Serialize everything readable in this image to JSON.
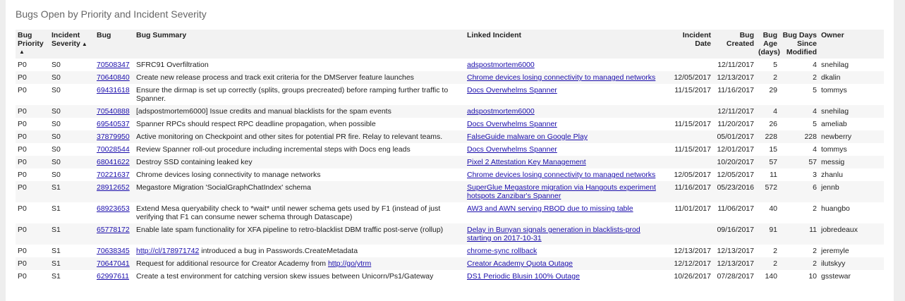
{
  "title": "Bugs Open by Priority and Incident Severity",
  "sort_up_glyph": "▲",
  "columns": [
    {
      "key": "priority",
      "label": "Bug Priority",
      "sorted": "asc",
      "arrow_below": true
    },
    {
      "key": "severity",
      "label": "Incident Severity",
      "sorted": "asc",
      "arrow_below": false
    },
    {
      "key": "bug",
      "label": "Bug"
    },
    {
      "key": "summary",
      "label": "Bug Summary"
    },
    {
      "key": "incident",
      "label": "Linked Incident"
    },
    {
      "key": "incident_date",
      "label": "Incident Date",
      "numeric": true
    },
    {
      "key": "bug_created",
      "label": "Bug Created",
      "numeric": true
    },
    {
      "key": "bug_age",
      "label": "Bug Age (days)",
      "numeric": true
    },
    {
      "key": "days_modified",
      "label": "Bug Days Since Modified",
      "numeric": true
    },
    {
      "key": "owner",
      "label": "Owner"
    }
  ],
  "rows": [
    {
      "priority": "P0",
      "severity": "S0",
      "bug": "70508347",
      "summary": [
        {
          "t": "SFRC91 Overfiltration"
        }
      ],
      "incident": "adspostmortem6000",
      "incident_date": "",
      "bug_created": "12/11/2017",
      "bug_age": "5",
      "days_modified": "4",
      "owner": "snehilag"
    },
    {
      "priority": "P0",
      "severity": "S0",
      "bug": "70640840",
      "summary": [
        {
          "t": "Create new release process and track exit criteria for the DMServer feature launches"
        }
      ],
      "incident": "Chrome devices losing connectivity to managed networks",
      "incident_date": "12/05/2017",
      "bug_created": "12/13/2017",
      "bug_age": "2",
      "days_modified": "2",
      "owner": "dkalin"
    },
    {
      "priority": "P0",
      "severity": "S0",
      "bug": "69431618",
      "summary": [
        {
          "t": "Ensure the dirmap is set up correctly (splits, groups precreated) before ramping further traffic to Spanner."
        }
      ],
      "incident": "Docs Overwhelms Spanner",
      "incident_date": "11/15/2017",
      "bug_created": "11/16/2017",
      "bug_age": "29",
      "days_modified": "5",
      "owner": "tommys"
    },
    {
      "priority": "P0",
      "severity": "S0",
      "bug": "70540888",
      "summary": [
        {
          "t": "[adspostmortem6000] Issue credits and manual blacklists for the spam events"
        }
      ],
      "incident": "adspostmortem6000",
      "incident_date": "",
      "bug_created": "12/11/2017",
      "bug_age": "4",
      "days_modified": "4",
      "owner": "snehilag"
    },
    {
      "priority": "P0",
      "severity": "S0",
      "bug": "69540537",
      "summary": [
        {
          "t": "Spanner RPCs should respect RPC deadline propagation, when possible"
        }
      ],
      "incident": "Docs Overwhelms Spanner",
      "incident_date": "11/15/2017",
      "bug_created": "11/20/2017",
      "bug_age": "26",
      "days_modified": "5",
      "owner": "ameliab"
    },
    {
      "priority": "P0",
      "severity": "S0",
      "bug": "37879950",
      "summary": [
        {
          "t": "Active monitoring on Checkpoint and other sites for potential PR fire. Relay to relevant teams."
        }
      ],
      "incident": "FalseGuide malware on Google Play",
      "incident_date": "",
      "bug_created": "05/01/2017",
      "bug_age": "228",
      "days_modified": "228",
      "owner": "newberry"
    },
    {
      "priority": "P0",
      "severity": "S0",
      "bug": "70028544",
      "summary": [
        {
          "t": "Review Spanner roll-out procedure including incremental steps with Docs eng leads"
        }
      ],
      "incident": "Docs Overwhelms Spanner",
      "incident_date": "11/15/2017",
      "bug_created": "12/01/2017",
      "bug_age": "15",
      "days_modified": "4",
      "owner": "tommys"
    },
    {
      "priority": "P0",
      "severity": "S0",
      "bug": "68041622",
      "summary": [
        {
          "t": "Destroy SSD containing leaked key"
        }
      ],
      "incident": "Pixel 2 Attestation Key Management",
      "incident_date": "",
      "bug_created": "10/20/2017",
      "bug_age": "57",
      "days_modified": "57",
      "owner": "messig"
    },
    {
      "priority": "P0",
      "severity": "S0",
      "bug": "70221637",
      "summary": [
        {
          "t": "Chrome devices losing connectivity to manage networks"
        }
      ],
      "incident": "Chrome devices losing connectivity to managed networks",
      "incident_date": "12/05/2017",
      "bug_created": "12/05/2017",
      "bug_age": "11",
      "days_modified": "3",
      "owner": "zhanlu"
    },
    {
      "priority": "P0",
      "severity": "S1",
      "bug": "28912652",
      "summary": [
        {
          "t": "Megastore Migration 'SocialGraphChatIndex' schema"
        }
      ],
      "incident": "SuperGlue Megastore migration via Hangouts experiment hotspots Zanzibar's Spanner",
      "incident_date": "11/16/2017",
      "bug_created": "05/23/2016",
      "bug_age": "572",
      "days_modified": "6",
      "owner": "jennb"
    },
    {
      "priority": "P0",
      "severity": "S1",
      "bug": "68923653",
      "summary": [
        {
          "t": "Extend Mesa queryability check to *wait* until newer schema gets used by F1 (instead of just verifying that F1 can consume newer schema through Datascape)"
        }
      ],
      "incident": "AW3 and AWN serving RBOD due to missing table",
      "incident_date": "11/01/2017",
      "bug_created": "11/06/2017",
      "bug_age": "40",
      "days_modified": "2",
      "owner": "huangbo"
    },
    {
      "priority": "P0",
      "severity": "S1",
      "bug": "65778172",
      "summary": [
        {
          "t": "Enable late spam functionality for XFA pipeline to retro-blacklist DBM traffic post-serve (rollup)"
        }
      ],
      "incident": "Delay in Bunyan signals generation in blacklists-prod starting on 2017-10-31",
      "incident_date": "",
      "bug_created": "09/16/2017",
      "bug_age": "91",
      "days_modified": "11",
      "owner": "jobredeaux"
    },
    {
      "priority": "P0",
      "severity": "S1",
      "bug": "70638345",
      "summary": [
        {
          "t": "http://cl/178971742",
          "link": true
        },
        {
          "t": " introduced a bug in Passwords.CreateMetadata"
        }
      ],
      "incident": "chrome-sync rollback",
      "incident_date": "12/13/2017",
      "bug_created": "12/13/2017",
      "bug_age": "2",
      "days_modified": "2",
      "owner": "jeremyle"
    },
    {
      "priority": "P0",
      "severity": "S1",
      "bug": "70647041",
      "summary": [
        {
          "t": "Request for additional resource for Creator Academy from "
        },
        {
          "t": "http://go/ytrm",
          "link": true
        }
      ],
      "incident": "Creator Academy Quota Outage",
      "incident_date": "12/12/2017",
      "bug_created": "12/13/2017",
      "bug_age": "2",
      "days_modified": "2",
      "owner": "ilutskyy"
    },
    {
      "priority": "P0",
      "severity": "S1",
      "bug": "62997611",
      "summary": [
        {
          "t": "Create a test environment for catching version skew issues between Unicorn/Ps1/Gateway"
        }
      ],
      "incident": "DS1 Periodic Blusin 100% Outage",
      "incident_date": "10/26/2017",
      "bug_created": "07/28/2017",
      "bug_age": "140",
      "days_modified": "10",
      "owner": "gsstewar"
    }
  ]
}
